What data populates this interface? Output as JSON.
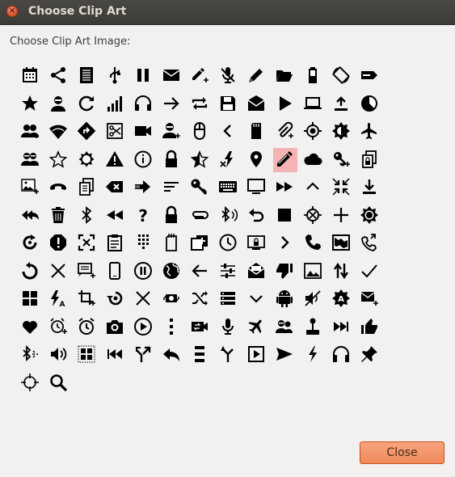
{
  "window": {
    "title": "Choose Clip Art",
    "close_glyph": "×"
  },
  "prompt": "Choose Clip Art Image:",
  "close_button_label": "Close",
  "colors": {
    "accent": "#f08a5c",
    "selection": "#f4b4b5",
    "icon": "#000000"
  },
  "selected_index": 48,
  "icons": [
    "calendar-icon",
    "share-icon",
    "document-lines-icon",
    "usb-icon",
    "pause-icon",
    "mail-icon",
    "edit-add-icon",
    "microphone-off-icon",
    "pencil-icon",
    "folder-open-icon",
    "battery-icon",
    "screen-rotation-icon",
    "label-icon",
    "star-icon",
    "person-icon",
    "refresh-icon",
    "signal-bars-icon",
    "headset-icon",
    "arrow-right-icon",
    "repeat-icon",
    "save-icon",
    "drafts-mail-icon",
    "play-icon",
    "laptop-icon",
    "upload-icon",
    "pie-chart-icon",
    "group-add-icon",
    "wifi-icon",
    "directions-icon",
    "cut-icon",
    "videocam-icon",
    "person-add-icon",
    "mouse-icon",
    "chevron-left-icon",
    "sd-card-icon",
    "attach-add-icon",
    "gps-fixed-icon",
    "brightness-icon",
    "airplane-icon",
    "people-icon",
    "star-outline-icon",
    "brightness-low-icon",
    "warning-icon",
    "info-icon",
    "lock-icon",
    "star-half-icon",
    "flash-off-icon",
    "location-pin-icon",
    "edit-icon",
    "cloud-icon",
    "key-add-icon",
    "copy-lock-icon",
    "image-add-icon",
    "call-end-icon",
    "copy-icon",
    "backspace-icon",
    "forward-icon",
    "sort-lines-icon",
    "key-icon",
    "keyboard-icon",
    "monitor-icon",
    "fast-forward-icon",
    "chevron-up-icon",
    "fullscreen-exit-icon",
    "download-icon",
    "reply-all-icon",
    "trash-icon",
    "bluetooth-icon",
    "rewind-icon",
    "help-icon",
    "lock-closed-icon",
    "attachment-icon",
    "bluetooth-audio-icon",
    "undo-icon",
    "stop-icon",
    "gps-off-icon",
    "plus-icon",
    "brightness-high-icon",
    "rotate-icon",
    "error-icon",
    "fullscreen-icon",
    "clipboard-icon",
    "dialpad-icon",
    "sd-storage-icon",
    "library-add-icon",
    "clock-icon",
    "screen-lock-icon",
    "chevron-right-icon",
    "phone-icon",
    "map-icon",
    "phone-forward-icon",
    "replay-icon",
    "close-icon",
    "message-add-icon",
    "smartphone-icon",
    "pause-circle-icon",
    "globe-icon",
    "arrow-left-icon",
    "tune-icon",
    "mail-open-icon",
    "thumb-down-icon",
    "photo-icon",
    "swap-vertical-icon",
    "check-icon",
    "dashboard-icon",
    "flash-auto-icon",
    "crop-add-icon",
    "replay-circle-icon",
    "close-x-icon",
    "rotate-camera-icon",
    "shuffle-icon",
    "list-icon",
    "chevron-down-icon",
    "android-icon",
    "volume-off-icon",
    "brightness-auto-icon",
    "mail-add-icon",
    "heart-icon",
    "alarm-add-icon",
    "alarm-icon",
    "camera-icon",
    "play-circle-icon",
    "more-vert-icon",
    "switch-video-icon",
    "mic-icon",
    "flight-icon",
    "supervisor-icon",
    "joystick-icon",
    "skip-next-icon",
    "thumb-up-icon",
    "bluetooth-search-icon",
    "volume-up-icon",
    "grid-select-icon",
    "skip-previous-icon",
    "call-split-icon",
    "reply-icon",
    "menu-icon",
    "call-merge-icon",
    "play-box-icon",
    "send-icon",
    "flash-icon",
    "headphones-icon",
    "pin-icon",
    "gps-crosshair-icon",
    "search-icon"
  ]
}
